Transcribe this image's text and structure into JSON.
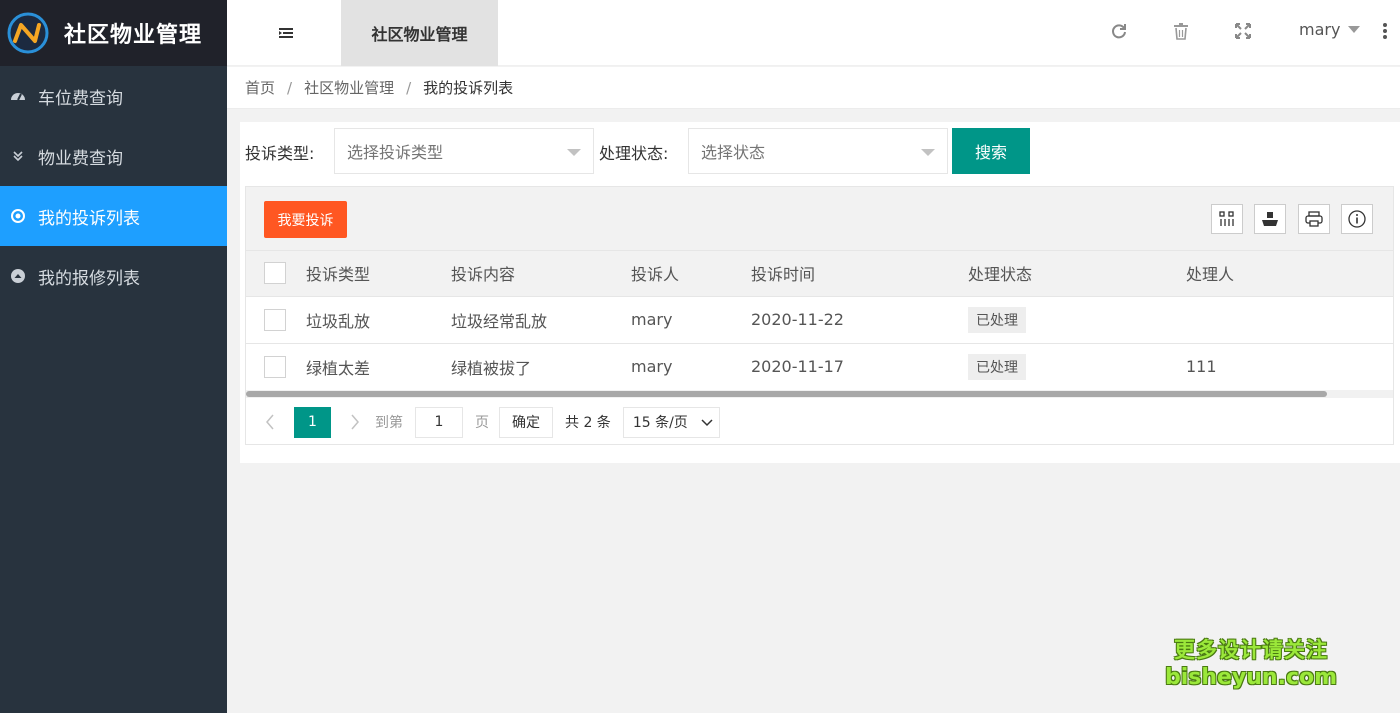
{
  "app": {
    "title": "社区物业管理"
  },
  "sidebar": {
    "items": [
      {
        "label": "车位费查询",
        "icon": "dashboard-icon",
        "active": false
      },
      {
        "label": "物业费查询",
        "icon": "chevron-double-down-icon",
        "active": false
      },
      {
        "label": "我的投诉列表",
        "icon": "radio-circle-icon",
        "active": true
      },
      {
        "label": "我的报修列表",
        "icon": "up-circle-icon",
        "active": false
      }
    ]
  },
  "header": {
    "tab_label": "社区物业管理",
    "username": "mary"
  },
  "breadcrumb": [
    "首页",
    "社区物业管理",
    "我的投诉列表"
  ],
  "filters": {
    "type_label": "投诉类型:",
    "type_placeholder": "选择投诉类型",
    "status_label": "处理状态:",
    "status_placeholder": "选择状态",
    "search_button": "搜索"
  },
  "toolbar": {
    "complaint_button": "我要投诉"
  },
  "table": {
    "columns": [
      "投诉类型",
      "投诉内容",
      "投诉人",
      "投诉时间",
      "处理状态",
      "处理人"
    ],
    "rows": [
      {
        "type": "垃圾乱放",
        "content": "垃圾经常乱放",
        "person": "mary",
        "time": "2020-11-22",
        "status": "已处理",
        "handler": ""
      },
      {
        "type": "绿植太差",
        "content": "绿植被拔了",
        "person": "mary",
        "time": "2020-11-17",
        "status": "已处理",
        "handler": "111"
      }
    ]
  },
  "pager": {
    "current_page": "1",
    "goto_label": "到第",
    "goto_value": "1",
    "page_unit": "页",
    "confirm_label": "确定",
    "total_label": "共 2 条",
    "page_size": "15 条/页"
  },
  "watermark": {
    "line1": "更多设计请关注",
    "line2": "bisheyun.com"
  },
  "colors": {
    "sidebar_bg": "#28333e",
    "active_nav": "#1e9fff",
    "primary": "#009688",
    "danger": "#ff5722"
  }
}
